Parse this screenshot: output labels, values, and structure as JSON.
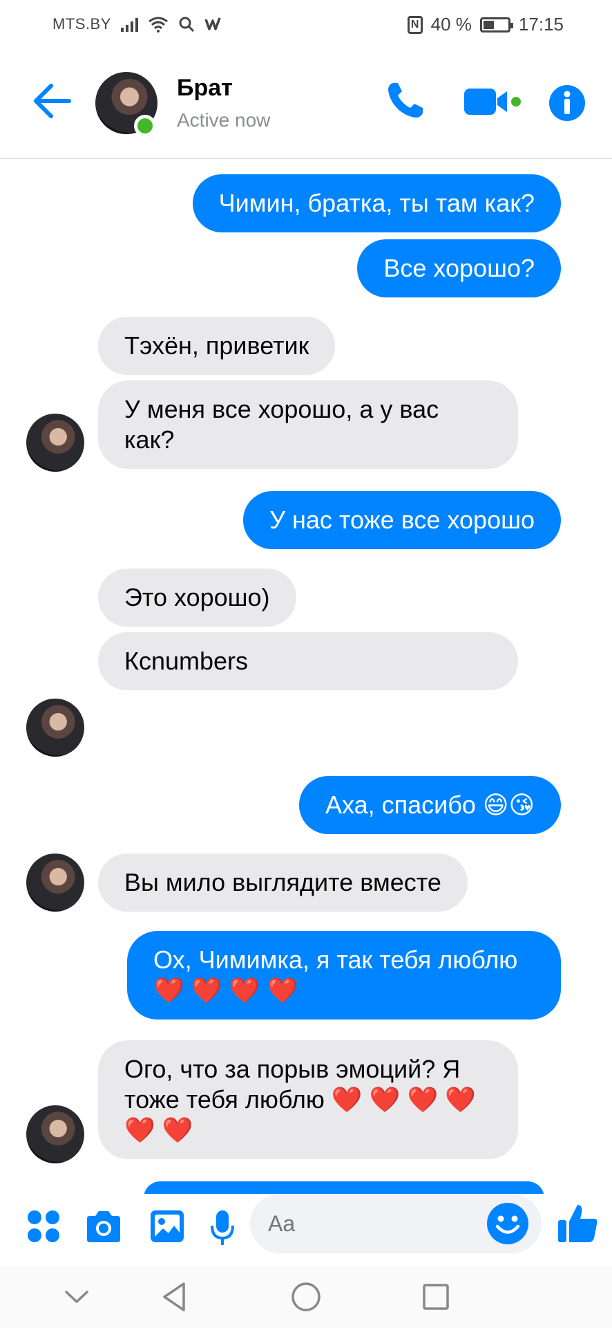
{
  "status_bar": {
    "carrier": "MTS.BY",
    "battery": "40 %",
    "battery_level": 0.4,
    "time": "17:15"
  },
  "header": {
    "contact_name": "Брат",
    "contact_status": "Active now"
  },
  "messages": [
    {
      "direction": "out",
      "text": "Чимин, братка, ты там как?"
    },
    {
      "direction": "out",
      "text": "Все хорошо?"
    },
    {
      "direction": "in",
      "text": "Тэхён, приветик"
    },
    {
      "direction": "in",
      "text": "У меня все хорошо, а у вас как?"
    },
    {
      "direction": "out",
      "text": "У нас тоже все хорошо"
    },
    {
      "direction": "in",
      "text": "Это хорошо)"
    },
    {
      "direction": "in",
      "text": "Ксnumbers",
      "placeholder": true
    },
    {
      "direction": "out",
      "text": "Аха, спасибо 😄😘"
    },
    {
      "direction": "in",
      "text": "Вы мило выглядите вместе"
    },
    {
      "direction": "out",
      "text": "Ох, Чимимка, я так тебя люблю ❤️ ❤️ ❤️ ❤️"
    },
    {
      "direction": "in",
      "text": "Ого, что за порыв эмоций? Я тоже тебя люблю ❤️ ❤️ ❤️ ❤️ ❤️ ❤️"
    }
  ],
  "composer": {
    "placeholder": "Aa"
  },
  "colors": {
    "accent": "#0084ff",
    "incoming_bubble": "#e9e9eb",
    "online": "#42b72a"
  }
}
